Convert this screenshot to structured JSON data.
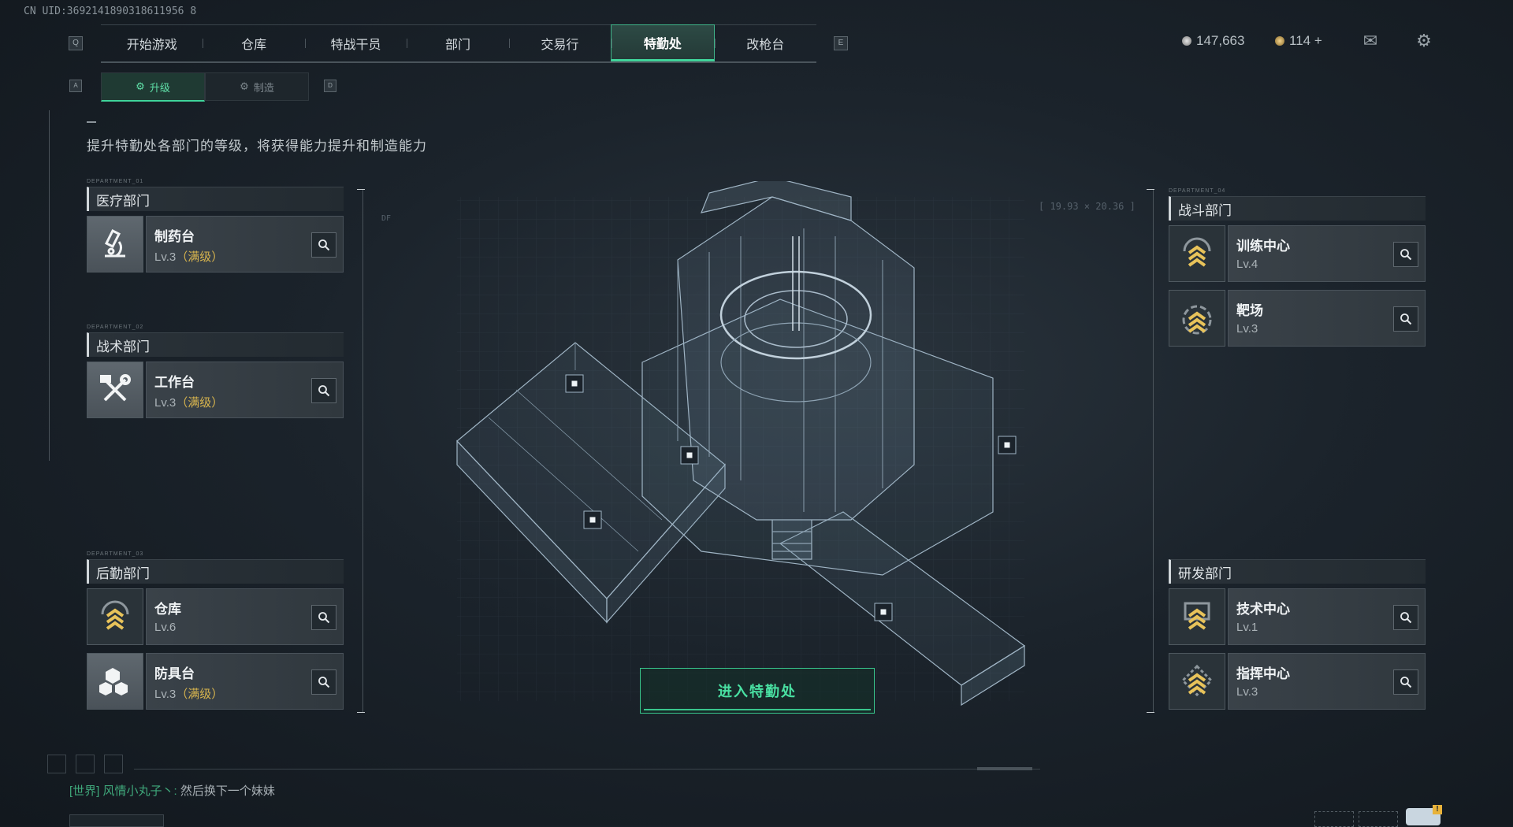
{
  "uid": "CN UID:3692141890318611956 8",
  "nav": {
    "left_key": "Q",
    "right_key": "E",
    "tabs": [
      "开始游戏",
      "仓库",
      "特战干员",
      "部门",
      "交易行",
      "特勤处",
      "改枪台"
    ],
    "active_tab": "特勤处"
  },
  "subnav": {
    "left_key": "A",
    "right_key": "D",
    "upgrade": "升级",
    "craft": "制造"
  },
  "currency": {
    "silver": "147,663",
    "gold": "114 +"
  },
  "description": "提升特勤处各部门的等级，将获得能力提升和制造能力",
  "departments": {
    "medical": {
      "tag": "DEPARTMENT_01",
      "title": "医疗部门",
      "items": [
        {
          "name": "制药台",
          "lv": "Lv.3",
          "max": "（满级）"
        }
      ]
    },
    "tactical": {
      "tag": "DEPARTMENT_02",
      "title": "战术部门",
      "items": [
        {
          "name": "工作台",
          "lv": "Lv.3",
          "max": "（满级）"
        }
      ]
    },
    "logistics": {
      "tag": "DEPARTMENT_03",
      "title": "后勤部门",
      "items": [
        {
          "name": "仓库",
          "lv": "Lv.6",
          "max": ""
        },
        {
          "name": "防具台",
          "lv": "Lv.3",
          "max": "（满级）"
        }
      ]
    },
    "combat": {
      "tag": "DEPARTMENT_04",
      "title": "战斗部门",
      "items": [
        {
          "name": "训练中心",
          "lv": "Lv.4",
          "max": ""
        },
        {
          "name": "靶场",
          "lv": "Lv.3",
          "max": ""
        }
      ]
    },
    "research": {
      "title": "研发部门",
      "items": [
        {
          "name": "技术中心",
          "lv": "Lv.1",
          "max": ""
        },
        {
          "name": "指挥中心",
          "lv": "Lv.3",
          "max": ""
        }
      ]
    }
  },
  "enter_button": "进入特勤处",
  "chat": {
    "channel": "[世界]",
    "sender": "风情小丸子丶:",
    "message": "然后换下一个妹妹"
  },
  "hud": {
    "coords": "[ 19.93 × 20.36 ]",
    "df": "DF"
  },
  "colors": {
    "accent": "#3fd49a",
    "max_level": "#d7b44e",
    "rank_chevron": "#e8c35a"
  }
}
